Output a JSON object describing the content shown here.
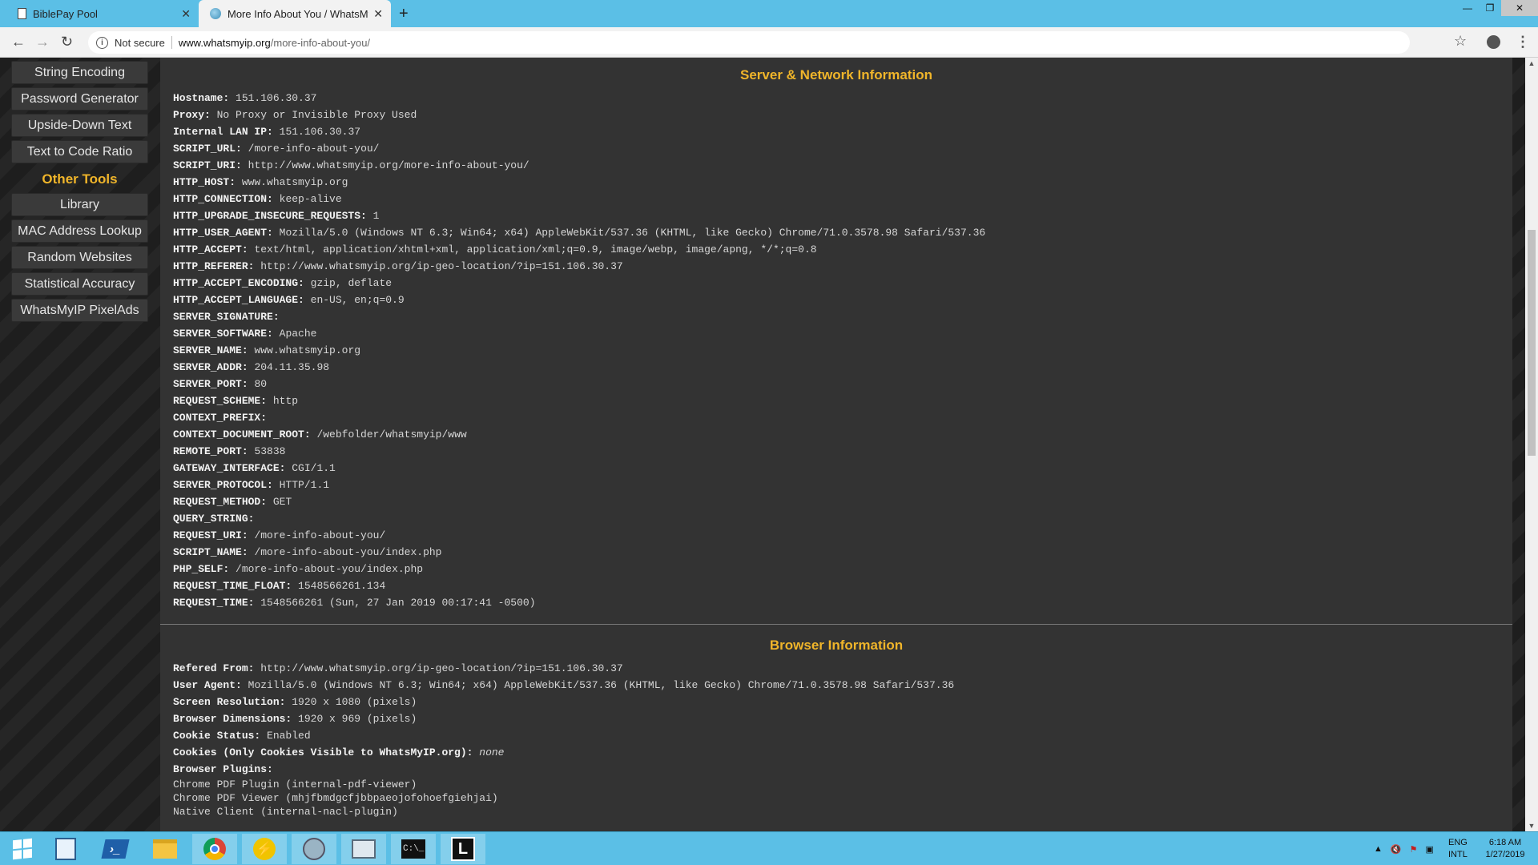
{
  "browser": {
    "tabs": [
      {
        "title": "BiblePay Pool",
        "active": false
      },
      {
        "title": "More Info About You / WhatsMy",
        "active": true
      }
    ],
    "new_tab": "+",
    "address": {
      "security_label": "Not secure",
      "host": "www.whatsmyip.org",
      "path": "/more-info-about-you/"
    }
  },
  "sidebar": {
    "top_items": [
      "String Encoding",
      "Password Generator",
      "Upside-Down Text",
      "Text to Code Ratio"
    ],
    "other_heading": "Other Tools",
    "other_items": [
      "Library",
      "MAC Address Lookup",
      "Random Websites",
      "Statistical Accuracy",
      "WhatsMyIP PixelAds"
    ]
  },
  "server_section": {
    "title": "Server & Network Information",
    "rows": [
      {
        "key": "Hostname:",
        "value": "151.106.30.37"
      },
      {
        "key": "Proxy:",
        "value": "No Proxy or Invisible Proxy Used"
      },
      {
        "key": "Internal LAN IP:",
        "value": "151.106.30.37"
      },
      {
        "key": "SCRIPT_URL:",
        "value": "/more-info-about-you/"
      },
      {
        "key": "SCRIPT_URI:",
        "value": "http://www.whatsmyip.org/more-info-about-you/"
      },
      {
        "key": "HTTP_HOST:",
        "value": "www.whatsmyip.org"
      },
      {
        "key": "HTTP_CONNECTION:",
        "value": "keep-alive"
      },
      {
        "key": "HTTP_UPGRADE_INSECURE_REQUESTS:",
        "value": "1"
      },
      {
        "key": "HTTP_USER_AGENT:",
        "value": "Mozilla/5.0 (Windows NT 6.3; Win64; x64) AppleWebKit/537.36 (KHTML, like Gecko) Chrome/71.0.3578.98 Safari/537.36"
      },
      {
        "key": "HTTP_ACCEPT:",
        "value": "text/html, application/xhtml+xml, application/xml;q=0.9, image/webp, image/apng, */*;q=0.8"
      },
      {
        "key": "HTTP_REFERER:",
        "value": "http://www.whatsmyip.org/ip-geo-location/?ip=151.106.30.37"
      },
      {
        "key": "HTTP_ACCEPT_ENCODING:",
        "value": "gzip, deflate"
      },
      {
        "key": "HTTP_ACCEPT_LANGUAGE:",
        "value": "en-US, en;q=0.9"
      },
      {
        "key": "SERVER_SIGNATURE:",
        "value": ""
      },
      {
        "key": "SERVER_SOFTWARE:",
        "value": "Apache"
      },
      {
        "key": "SERVER_NAME:",
        "value": "www.whatsmyip.org"
      },
      {
        "key": "SERVER_ADDR:",
        "value": "204.11.35.98"
      },
      {
        "key": "SERVER_PORT:",
        "value": "80"
      },
      {
        "key": "REQUEST_SCHEME:",
        "value": "http"
      },
      {
        "key": "CONTEXT_PREFIX:",
        "value": ""
      },
      {
        "key": "CONTEXT_DOCUMENT_ROOT:",
        "value": "/webfolder/whatsmyip/www"
      },
      {
        "key": "REMOTE_PORT:",
        "value": "53838"
      },
      {
        "key": "GATEWAY_INTERFACE:",
        "value": "CGI/1.1"
      },
      {
        "key": "SERVER_PROTOCOL:",
        "value": "HTTP/1.1"
      },
      {
        "key": "REQUEST_METHOD:",
        "value": "GET"
      },
      {
        "key": "QUERY_STRING:",
        "value": ""
      },
      {
        "key": "REQUEST_URI:",
        "value": "/more-info-about-you/"
      },
      {
        "key": "SCRIPT_NAME:",
        "value": "/more-info-about-you/index.php"
      },
      {
        "key": "PHP_SELF:",
        "value": "/more-info-about-you/index.php"
      },
      {
        "key": "REQUEST_TIME_FLOAT:",
        "value": "1548566261.134"
      },
      {
        "key": "REQUEST_TIME:",
        "value": "1548566261 (Sun, 27 Jan 2019 00:17:41 -0500)"
      }
    ]
  },
  "browser_section": {
    "title": "Browser Information",
    "rows": [
      {
        "key": "Refered From:",
        "value": "http://www.whatsmyip.org/ip-geo-location/?ip=151.106.30.37"
      },
      {
        "key": "User Agent:",
        "value": "Mozilla/5.0 (Windows NT 6.3; Win64; x64) AppleWebKit/537.36 (KHTML, like Gecko) Chrome/71.0.3578.98 Safari/537.36"
      },
      {
        "key": "Screen Resolution:",
        "value": "1920 x 1080 (pixels)"
      },
      {
        "key": "Browser Dimensions:",
        "value": "1920 x 969 (pixels)"
      },
      {
        "key": "Cookie Status:",
        "value": "Enabled"
      }
    ],
    "cookies_key": "Cookies (Only Cookies Visible to WhatsMyIP.org):",
    "cookies_value": "none",
    "plugins_key": "Browser Plugins:",
    "plugins": [
      "Chrome PDF Plugin (internal-pdf-viewer)",
      "Chrome PDF Viewer (mhjfbmdgcfjbbpaeojofohoefgiehjai)",
      "Native Client (internal-nacl-plugin)"
    ]
  },
  "taskbar": {
    "apps": [
      "start-icon",
      "server-manager-icon",
      "powershell-icon",
      "file-explorer-icon",
      "chrome-icon",
      "bolt-app-icon",
      "globe-app-icon",
      "chart-app-icon",
      "cmd-icon",
      "l-app-icon"
    ],
    "lang_top": "ENG",
    "lang_bottom": "INTL",
    "time": "6:18 AM",
    "date": "1/27/2019"
  },
  "colors": {
    "accent": "#f0b52a",
    "panel": "#333333",
    "taskbar": "#5bbfe6"
  }
}
